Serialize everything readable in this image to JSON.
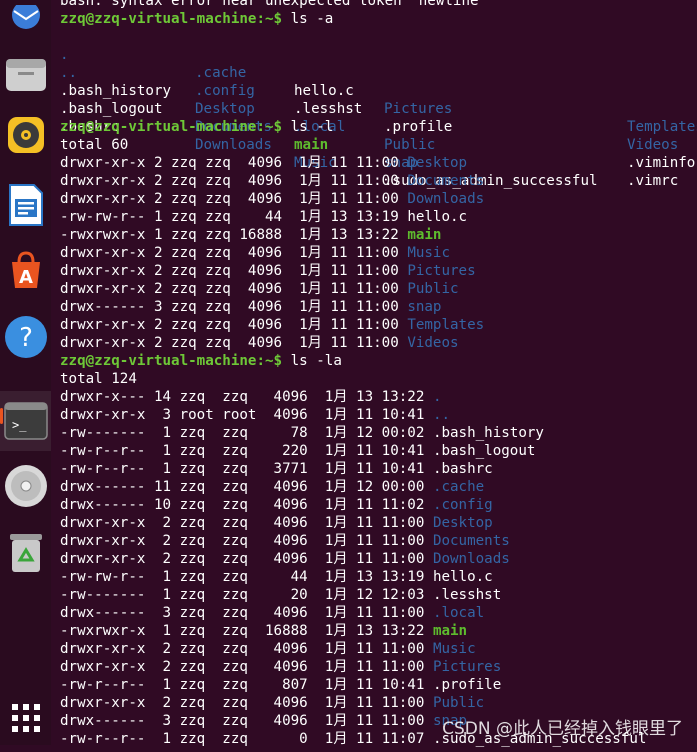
{
  "dock": {
    "items": [
      {
        "id": "thunderbird",
        "icon": "thunderbird-icon"
      },
      {
        "id": "files",
        "icon": "files-icon"
      },
      {
        "id": "rhythmbox",
        "icon": "rhythmbox-icon"
      },
      {
        "id": "writer",
        "icon": "libreoffice-writer-icon"
      },
      {
        "id": "software",
        "icon": "software-store-icon"
      },
      {
        "id": "help",
        "icon": "help-icon",
        "label": "?"
      },
      {
        "id": "terminal",
        "icon": "terminal-icon",
        "label": ">_"
      },
      {
        "id": "dvd",
        "icon": "optical-disc-icon"
      },
      {
        "id": "trash",
        "icon": "trash-icon"
      },
      {
        "id": "apps",
        "icon": "app-grid-icon"
      }
    ]
  },
  "terminal": {
    "prompt": "zzq@zzq-virtual-machine:~$",
    "error_line": "bash: syntax error near unexpected token `newline'",
    "cmd1": " ls -a",
    "ls_a": {
      "rows": [
        [
          ".",
          ".cache",
          "hello.c",
          "Pictures",
          "Templates"
        ],
        [
          "..",
          ".config",
          ".lesshst",
          ".profile",
          "Videos"
        ],
        [
          ".bash_history",
          "Desktop",
          ".local",
          "Public",
          ".viminfo"
        ],
        [
          ".bash_logout",
          "Documents",
          "main",
          "snap",
          ".vimrc"
        ],
        [
          ".bashrc",
          "Downloads",
          "Music",
          ".sudo_as_admin_successful",
          ""
        ]
      ]
    },
    "cmd2": " ls -l",
    "ls_l_total": "total 60",
    "ls_l": [
      {
        "meta": "drwxr-xr-x 2 zzq zzq  4096  1月 11 11:00 ",
        "name": "Desktop"
      },
      {
        "meta": "drwxr-xr-x 2 zzq zzq  4096  1月 11 11:00 ",
        "name": "Documents"
      },
      {
        "meta": "drwxr-xr-x 2 zzq zzq  4096  1月 11 11:00 ",
        "name": "Downloads"
      },
      {
        "meta": "-rw-rw-r-- 1 zzq zzq    44  1月 13 13:19 ",
        "name": "hello.c"
      },
      {
        "meta": "-rwxrwxr-x 1 zzq zzq 16888  1月 13 13:22 ",
        "name": "main"
      },
      {
        "meta": "drwxr-xr-x 2 zzq zzq  4096  1月 11 11:00 ",
        "name": "Music"
      },
      {
        "meta": "drwxr-xr-x 2 zzq zzq  4096  1月 11 11:00 ",
        "name": "Pictures"
      },
      {
        "meta": "drwxr-xr-x 2 zzq zzq  4096  1月 11 11:00 ",
        "name": "Public"
      },
      {
        "meta": "drwx------ 3 zzq zzq  4096  1月 11 11:00 ",
        "name": "snap"
      },
      {
        "meta": "drwxr-xr-x 2 zzq zzq  4096  1月 11 11:00 ",
        "name": "Templates"
      },
      {
        "meta": "drwxr-xr-x 2 zzq zzq  4096  1月 11 11:00 ",
        "name": "Videos"
      }
    ],
    "cmd3": " ls -la",
    "ls_la_total": "total 124",
    "ls_la": [
      {
        "meta": "drwxr-x--- 14 zzq  zzq   4096  1月 13 13:22 ",
        "name": "."
      },
      {
        "meta": "drwxr-xr-x  3 root root  4096  1月 11 10:41 ",
        "name": ".."
      },
      {
        "meta": "-rw-------  1 zzq  zzq     78  1月 12 00:02 ",
        "name": ".bash_history"
      },
      {
        "meta": "-rw-r--r--  1 zzq  zzq    220  1月 11 10:41 ",
        "name": ".bash_logout"
      },
      {
        "meta": "-rw-r--r--  1 zzq  zzq   3771  1月 11 10:41 ",
        "name": ".bashrc"
      },
      {
        "meta": "drwx------ 11 zzq  zzq   4096  1月 12 00:00 ",
        "name": ".cache"
      },
      {
        "meta": "drwx------ 10 zzq  zzq   4096  1月 11 11:02 ",
        "name": ".config"
      },
      {
        "meta": "drwxr-xr-x  2 zzq  zzq   4096  1月 11 11:00 ",
        "name": "Desktop"
      },
      {
        "meta": "drwxr-xr-x  2 zzq  zzq   4096  1月 11 11:00 ",
        "name": "Documents"
      },
      {
        "meta": "drwxr-xr-x  2 zzq  zzq   4096  1月 11 11:00 ",
        "name": "Downloads"
      },
      {
        "meta": "-rw-rw-r--  1 zzq  zzq     44  1月 13 13:19 ",
        "name": "hello.c"
      },
      {
        "meta": "-rw-------  1 zzq  zzq     20  1月 12 12:03 ",
        "name": ".lesshst"
      },
      {
        "meta": "drwx------  3 zzq  zzq   4096  1月 11 11:00 ",
        "name": ".local"
      },
      {
        "meta": "-rwxrwxr-x  1 zzq  zzq  16888  1月 13 13:22 ",
        "name": "main"
      },
      {
        "meta": "drwxr-xr-x  2 zzq  zzq   4096  1月 11 11:00 ",
        "name": "Music"
      },
      {
        "meta": "drwxr-xr-x  2 zzq  zzq   4096  1月 11 11:00 ",
        "name": "Pictures"
      },
      {
        "meta": "-rw-r--r--  1 zzq  zzq    807  1月 11 10:41 ",
        "name": ".profile"
      },
      {
        "meta": "drwxr-xr-x  2 zzq  zzq   4096  1月 11 11:00 ",
        "name": "Public"
      },
      {
        "meta": "drwx------  3 zzq  zzq   4096  1月 11 11:00 ",
        "name": "snap"
      },
      {
        "meta": "-rw-r--r--  1 zzq  zzq      0  1月 11 11:07 ",
        "name": ".sudo_as_admin_successful"
      }
    ]
  },
  "watermark": "CSDN @此人已经掉入钱眼里了",
  "colors": {
    "background": "#300a24",
    "prompt": "#6ec837",
    "directory": "#3465a4",
    "executable": "#5ebc2e",
    "accent": "#e95420"
  }
}
